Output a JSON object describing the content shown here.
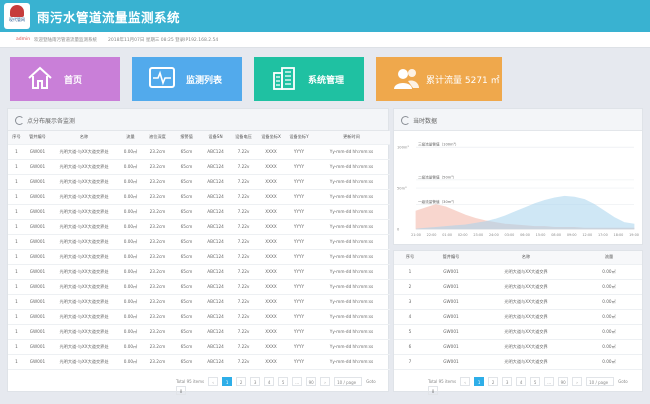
{
  "app": {
    "logo_text": "现代管网",
    "title": "雨污水管道流量监测系统"
  },
  "infobar": {
    "user": "admin",
    "greeting": "欢迎登陆雨污管道流量监测系统",
    "time_info": "2018年11月07日 星期三 08:25 登录IP192.168.2.54"
  },
  "tiles": [
    {
      "label": "首页",
      "color": "#c97fd8",
      "icon": "home-icon"
    },
    {
      "label": "监测列表",
      "color": "#52aaec",
      "icon": "monitor-icon"
    },
    {
      "label": "系统管理",
      "color": "#1fc1a2",
      "icon": "building-icon"
    },
    {
      "label": "累计流量  5271 ㎡",
      "color": "#efa84c",
      "icon": "users-icon"
    }
  ],
  "left_panel": {
    "title": "点分布展示各监测",
    "columns": [
      "序号",
      "管井编号",
      "名称",
      "流量",
      "液位深度",
      "报警值",
      "设备SN",
      "设备电压",
      "设备坐标X",
      "设备坐标Y",
      "更新时间"
    ],
    "rows": [
      [
        "1",
        "GW001",
        "光明大道-与XX大道交界处",
        "0.00㎡",
        "23.2cm",
        "65cm",
        "ABC124",
        "7.22v",
        "XXXX",
        "YYYY",
        "Yy-mm-dd hh:mm:ss"
      ],
      [
        "1",
        "GW001",
        "光明大道-与XX大道交界处",
        "0.00㎡",
        "23.2cm",
        "65cm",
        "ABC124",
        "7.22v",
        "XXXX",
        "YYYY",
        "Yy-mm-dd hh:mm:ss"
      ],
      [
        "1",
        "GW001",
        "光明大道-与XX大道交界处",
        "0.00㎡",
        "23.2cm",
        "65cm",
        "ABC124",
        "7.22v",
        "XXXX",
        "YYYY",
        "Yy-mm-dd hh:mm:ss"
      ],
      [
        "1",
        "GW001",
        "光明大道-与XX大道交界处",
        "0.00㎡",
        "23.2cm",
        "65cm",
        "ABC124",
        "7.22v",
        "XXXX",
        "YYYY",
        "Yy-mm-dd hh:mm:ss"
      ],
      [
        "1",
        "GW001",
        "光明大道-与XX大道交界处",
        "0.00㎡",
        "23.2cm",
        "65cm",
        "ABC124",
        "7.22v",
        "XXXX",
        "YYYY",
        "Yy-mm-dd hh:mm:ss"
      ],
      [
        "1",
        "GW001",
        "光明大道-与XX大道交界处",
        "0.00㎡",
        "23.2cm",
        "65cm",
        "ABC124",
        "7.22v",
        "XXXX",
        "YYYY",
        "Yy-mm-dd hh:mm:ss"
      ],
      [
        "1",
        "GW001",
        "光明大道-与XX大道交界处",
        "0.00㎡",
        "23.2cm",
        "65cm",
        "ABC124",
        "7.22v",
        "XXXX",
        "YYYY",
        "Yy-mm-dd hh:mm:ss"
      ],
      [
        "1",
        "GW001",
        "光明大道-与XX大道交界处",
        "0.00㎡",
        "23.2cm",
        "65cm",
        "ABC124",
        "7.22v",
        "XXXX",
        "YYYY",
        "Yy-mm-dd hh:mm:ss"
      ],
      [
        "1",
        "GW001",
        "光明大道-与XX大道交界处",
        "0.00㎡",
        "23.2cm",
        "65cm",
        "ABC124",
        "7.22v",
        "XXXX",
        "YYYY",
        "Yy-mm-dd hh:mm:ss"
      ],
      [
        "1",
        "GW001",
        "光明大道-与XX大道交界处",
        "0.00㎡",
        "23.2cm",
        "65cm",
        "ABC124",
        "7.22v",
        "XXXX",
        "YYYY",
        "Yy-mm-dd hh:mm:ss"
      ],
      [
        "1",
        "GW001",
        "光明大道-与XX大道交界处",
        "0.00㎡",
        "23.2cm",
        "65cm",
        "ABC124",
        "7.22v",
        "XXXX",
        "YYYY",
        "Yy-mm-dd hh:mm:ss"
      ],
      [
        "1",
        "GW001",
        "光明大道-与XX大道交界处",
        "0.00㎡",
        "23.2cm",
        "65cm",
        "ABC124",
        "7.22v",
        "XXXX",
        "YYYY",
        "Yy-mm-dd hh:mm:ss"
      ],
      [
        "1",
        "GW001",
        "光明大道-与XX大道交界处",
        "0.00㎡",
        "23.2cm",
        "65cm",
        "ABC124",
        "7.22v",
        "XXXX",
        "YYYY",
        "Yy-mm-dd hh:mm:ss"
      ],
      [
        "1",
        "GW001",
        "光明大道-与XX大道交界处",
        "0.00㎡",
        "23.2cm",
        "65cm",
        "ABC124",
        "7.22v",
        "XXXX",
        "YYYY",
        "Yy-mm-dd hh:mm:ss"
      ],
      [
        "1",
        "GW001",
        "光明大道-与XX大道交界处",
        "0.00㎡",
        "23.2cm",
        "65cm",
        "ABC124",
        "7.22v",
        "XXXX",
        "YYYY",
        "Yy-mm-dd hh:mm:ss"
      ]
    ],
    "pager": {
      "total": "Total 95 items",
      "pages": [
        "1",
        "2",
        "3",
        "4",
        "5",
        "...",
        "90"
      ],
      "next": "›",
      "prev": "‹",
      "per_page": "10 / page",
      "goto": "Goto",
      "goto_value": "8"
    }
  },
  "chart_panel": {
    "title": "当时数据",
    "yaxis_ticks": [
      "100m³",
      "50m³",
      "0"
    ],
    "bands": [
      {
        "label": "三级流量警值（100m³）"
      },
      {
        "label": "二级流量警值（50m³）"
      },
      {
        "label": "一级流量警值（30m³）"
      }
    ]
  },
  "chart_data": {
    "type": "area",
    "x": [
      "21:00",
      "22:00",
      "23:00",
      "00:00",
      "01:00",
      "02:00",
      "03:00",
      "04:00",
      "05:00",
      "06:00",
      "07:00",
      "08:00",
      "09:00",
      "10:00",
      "11:00",
      "12:00",
      "13:00",
      "14:00",
      "15:00",
      "16:00",
      "17:00",
      "18:00",
      "19:00"
    ],
    "xticks": [
      "21:00",
      "22:00",
      "01:00",
      "02:00",
      "23:00",
      "24:00",
      "03:00",
      "06:00",
      "15:00",
      "08:00",
      "09:00",
      "12:00",
      "17:00",
      "18:00",
      "19:00"
    ],
    "series": [
      {
        "color": "#f3b6a7",
        "values": [
          22,
          26,
          30,
          27,
          22,
          17,
          13,
          10,
          8,
          6,
          5,
          4,
          3,
          3,
          2,
          2,
          2,
          1,
          1,
          1,
          1,
          1,
          1
        ]
      },
      {
        "color": "#a8d4ee",
        "values": [
          0,
          1,
          2,
          3,
          4,
          5,
          7,
          9,
          12,
          16,
          21,
          26,
          31,
          35,
          38,
          40,
          39,
          36,
          30,
          22,
          14,
          8,
          6
        ]
      }
    ],
    "ylim": [
      0,
      110
    ],
    "grid": true
  },
  "right_table": {
    "columns": [
      "序号",
      "管井编号",
      "名称",
      "流量"
    ],
    "rows": [
      [
        "1",
        "GW001",
        "光明大道与XX大道交界",
        "0.00㎡"
      ],
      [
        "2",
        "GW001",
        "光明大道与XX大道交界",
        "0.00㎡"
      ],
      [
        "3",
        "GW001",
        "光明大道与XX大道交界",
        "0.00㎡"
      ],
      [
        "4",
        "GW001",
        "光明大道与XX大道交界",
        "0.00㎡"
      ],
      [
        "5",
        "GW001",
        "光明大道与XX大道交界",
        "0.00㎡"
      ],
      [
        "6",
        "GW001",
        "光明大道与XX大道交界",
        "0.00㎡"
      ],
      [
        "7",
        "GW001",
        "光明大道与XX大道交界",
        "0.00㎡"
      ]
    ],
    "pager": {
      "total": "Total 95 items",
      "pages": [
        "1",
        "2",
        "3",
        "4",
        "5",
        "...",
        "90"
      ],
      "next": "›",
      "prev": "‹",
      "per_page": "10 / page",
      "goto": "Goto",
      "goto_value": "8"
    }
  }
}
